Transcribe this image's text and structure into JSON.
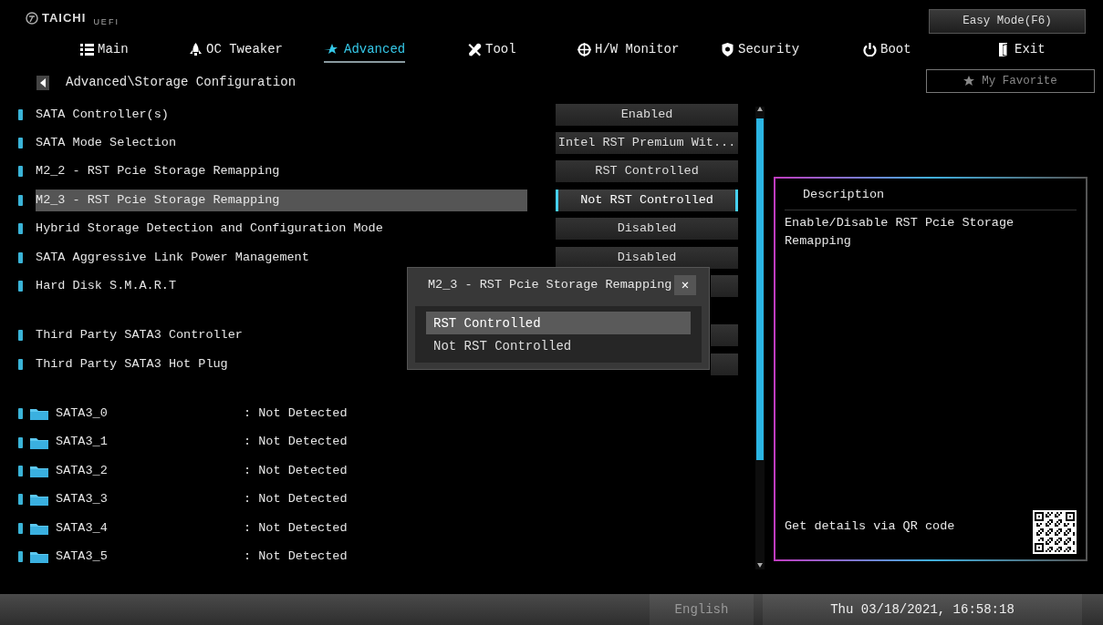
{
  "logo": {
    "brand": "TAICHI",
    "suffix": "UEFI"
  },
  "easy_mode_button": "Easy Mode(F6)",
  "tabs": [
    {
      "label": "Main",
      "selected": false
    },
    {
      "label": "OC Tweaker",
      "selected": false
    },
    {
      "label": "Advanced",
      "selected": true
    },
    {
      "label": "Tool",
      "selected": false
    },
    {
      "label": "H/W Monitor",
      "selected": false
    },
    {
      "label": "Security",
      "selected": false
    },
    {
      "label": "Boot",
      "selected": false
    },
    {
      "label": "Exit",
      "selected": false
    }
  ],
  "favorite_button": "My Favorite",
  "breadcrumb": "Advanced\\Storage Configuration",
  "sections": [
    {
      "items": [
        {
          "kind": "setting",
          "label": "SATA Controller(s)",
          "value": "Enabled",
          "selected": false
        },
        {
          "kind": "setting",
          "label": "SATA Mode Selection",
          "value": "Intel RST Premium Wit...",
          "selected": false
        },
        {
          "kind": "setting",
          "label": "M2_2 - RST Pcie Storage Remapping",
          "value": "RST Controlled",
          "selected": false
        },
        {
          "kind": "setting",
          "label": "M2_3 - RST Pcie Storage Remapping",
          "value": "Not RST Controlled",
          "selected": true
        },
        {
          "kind": "setting",
          "label": "Hybrid Storage Detection and Configuration Mode",
          "value": "Disabled",
          "selected": false
        },
        {
          "kind": "setting",
          "label": "SATA Aggressive Link Power Management",
          "value": "Disabled",
          "selected": false
        },
        {
          "kind": "setting",
          "label": "Hard Disk S.M.A.R.T",
          "selected": false
        }
      ]
    },
    {
      "items": [
        {
          "kind": "setting",
          "label": "Third Party SATA3 Controller",
          "selected": false
        },
        {
          "kind": "setting",
          "label": "Third Party SATA3 Hot Plug",
          "selected": false
        }
      ]
    },
    {
      "items": [
        {
          "kind": "port",
          "label": "SATA3_0",
          "status": ": Not Detected"
        },
        {
          "kind": "port",
          "label": "SATA3_1",
          "status": ": Not Detected"
        },
        {
          "kind": "port",
          "label": "SATA3_2",
          "status": ": Not Detected"
        },
        {
          "kind": "port",
          "label": "SATA3_3",
          "status": ": Not Detected"
        },
        {
          "kind": "port",
          "label": "SATA3_4",
          "status": ": Not Detected"
        },
        {
          "kind": "port",
          "label": "SATA3_5",
          "status": ": Not Detected"
        }
      ]
    }
  ],
  "popup": {
    "title": "M2_3 - RST Pcie Storage Remapping",
    "close": "✕",
    "options": [
      {
        "label": "RST Controlled",
        "selected": true
      },
      {
        "label": "Not RST Controlled",
        "selected": false
      }
    ]
  },
  "description": {
    "title": "Description",
    "text": "Enable/Disable RST Pcie Storage Remapping",
    "qr_caption": "Get details via QR code"
  },
  "status_bar": {
    "language": "English",
    "datetime": "Thu 03/18/2021, 16:58:18"
  }
}
